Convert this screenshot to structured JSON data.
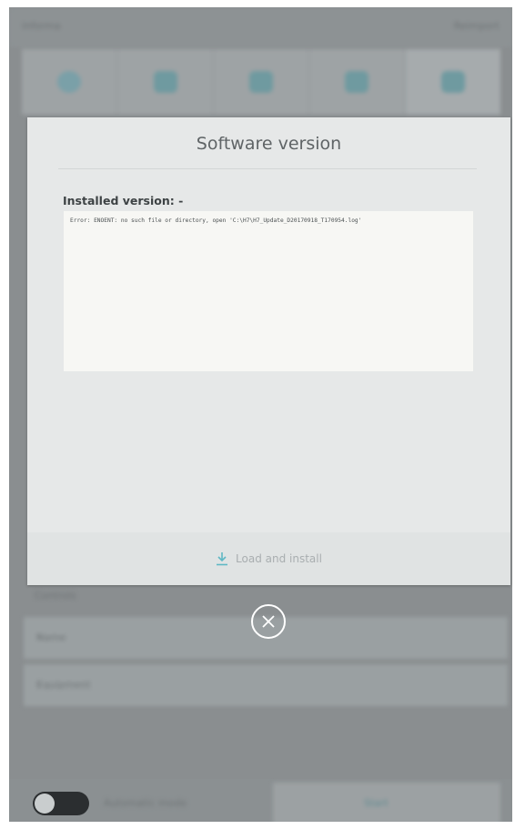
{
  "background": {
    "header": {
      "left_text": "Informa",
      "right_text": "Reimport"
    },
    "toolbar": {
      "buttons": [
        {
          "icon": "gear-icon"
        },
        {
          "icon": "edit-icon"
        },
        {
          "icon": "wrench-icon"
        },
        {
          "icon": "monitor-icon"
        },
        {
          "icon": "tools-icon"
        }
      ]
    },
    "section_label": "Controls",
    "list_items": [
      {
        "label": "Name"
      },
      {
        "label": "Equipment"
      }
    ],
    "footer": {
      "toggle_label": "Automatic mode",
      "start_label": "Start"
    }
  },
  "modal": {
    "title": "Software version",
    "installed_label": "Installed version: -",
    "log_text": "Error: ENOENT: no such file or directory, open 'C:\\H7\\H7_Update_D20170918_T170954.log'",
    "load_button_label": "Load and install",
    "accent_color": "#5fb8c4"
  },
  "close_icon": "close-circle-icon"
}
